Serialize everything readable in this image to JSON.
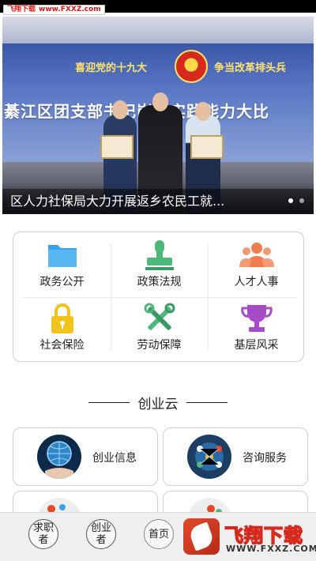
{
  "watermark_top": {
    "brand": "飞翔下载",
    "url": "www.FXXZ.com"
  },
  "banner": {
    "slogan_left": "喜迎党的十九大",
    "slogan_right": "争当改革排头兵",
    "stage_headline": "綦江区团支部书记岗位实践能力大比",
    "caption": "区人力社保局大力开展返乡农民工就...",
    "slide_count": 2,
    "active_slide": 1
  },
  "grid": {
    "items": [
      {
        "label": "政务公开",
        "icon": "folder-icon",
        "color": "#3aa0e8"
      },
      {
        "label": "政策法规",
        "icon": "stamp-icon",
        "color": "#4cb87a"
      },
      {
        "label": "人才人事",
        "icon": "people-icon",
        "color": "#f07b4e"
      },
      {
        "label": "社会保险",
        "icon": "lock-icon",
        "color": "#f2c318"
      },
      {
        "label": "劳动保障",
        "icon": "tools-icon",
        "color": "#4cb87a"
      },
      {
        "label": "基层风采",
        "icon": "trophy-icon",
        "color": "#a64cc6"
      }
    ]
  },
  "section": {
    "title": "创业云"
  },
  "services": [
    {
      "label": "创业信息",
      "icon": "globe-hand-icon"
    },
    {
      "label": "咨询服务",
      "icon": "consult-icon"
    }
  ],
  "bottom_nav": {
    "items": [
      {
        "label": "求职者"
      },
      {
        "label": "创业者"
      },
      {
        "label": "首页"
      }
    ]
  },
  "watermark_bottom": {
    "brand": "飞翔下载",
    "url": "WWW.FXXZ.COM"
  }
}
